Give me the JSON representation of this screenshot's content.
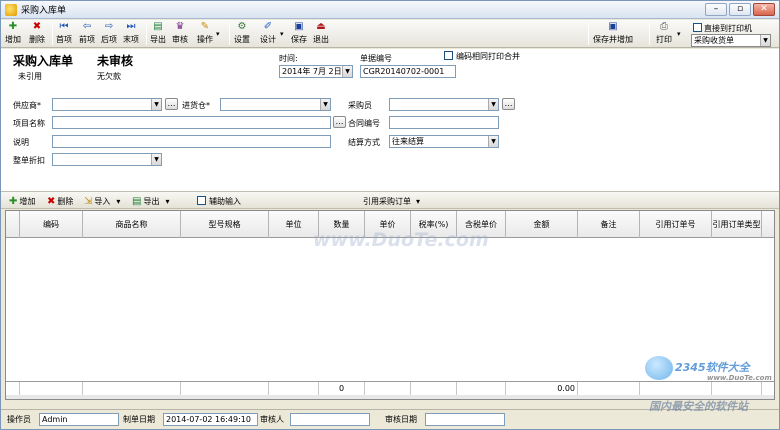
{
  "window": {
    "title": "采购入库单"
  },
  "toolbar": {
    "items": [
      {
        "label": "增加",
        "icon": "add-icon"
      },
      {
        "label": "删除",
        "icon": "delete-icon"
      },
      {
        "label": "首项",
        "icon": "first-icon"
      },
      {
        "label": "前项",
        "icon": "prev-icon"
      },
      {
        "label": "后项",
        "icon": "next-icon"
      },
      {
        "label": "末项",
        "icon": "last-icon"
      },
      {
        "label": "导出",
        "icon": "export-icon"
      },
      {
        "label": "审核",
        "icon": "audit-icon"
      },
      {
        "label": "操作",
        "icon": "operate-icon"
      },
      {
        "label": "设置",
        "icon": "settings-icon"
      },
      {
        "label": "设计",
        "icon": "design-icon"
      },
      {
        "label": "保存",
        "icon": "save-icon"
      },
      {
        "label": "退出",
        "icon": "exit-icon"
      },
      {
        "label": "保存并增加",
        "icon": "save-add-icon"
      },
      {
        "label": "打印",
        "icon": "print-icon"
      }
    ],
    "direct_print_label": "直接到打印机",
    "print_template": "采购收货单"
  },
  "form": {
    "doc_title": "采购入库单",
    "audit_status": "未审核",
    "ref_status": "未引用",
    "debt_status": "无欠款",
    "time_label": "时间:",
    "time_value": "2014年 7月 2日",
    "doc_no_label": "单据编号",
    "doc_no_value": "CGR20140702-0001",
    "merge_print_label": "编码相同打印合并",
    "supplier_label": "供应商*",
    "warehouse_label": "进货仓*",
    "buyer_label": "采购员",
    "project_label": "项目名称",
    "contract_label": "合同编号",
    "note_label": "说明",
    "settle_label": "结算方式",
    "settle_value": "往来结算",
    "discount_label": "整单折扣"
  },
  "gridbar": {
    "add": "增加",
    "delete": "删除",
    "import": "导入",
    "export": "导出",
    "assist_input": "辅助输入",
    "ref_order": "引用采购订单"
  },
  "grid": {
    "columns": [
      "编码",
      "商品名称",
      "型号规格",
      "单位",
      "数量",
      "单价",
      "税率(%)",
      "含税单价",
      "金额",
      "备注",
      "引用订单号",
      "引用订单类型"
    ],
    "footer_qty": "0",
    "footer_amount": "0.00"
  },
  "status": {
    "operator_label": "操作员",
    "operator_value": "Admin",
    "make_date_label": "制单日期",
    "make_date_value": "2014-07-02 16:49:10",
    "auditor_label": "审核人",
    "audit_date_label": "审核日期"
  },
  "watermarks": {
    "site": "www.DuoTe.com",
    "brand": "2345软件大全",
    "brand_url": "www.DuoTe.com",
    "slogan": "国内最安全的软件站"
  }
}
